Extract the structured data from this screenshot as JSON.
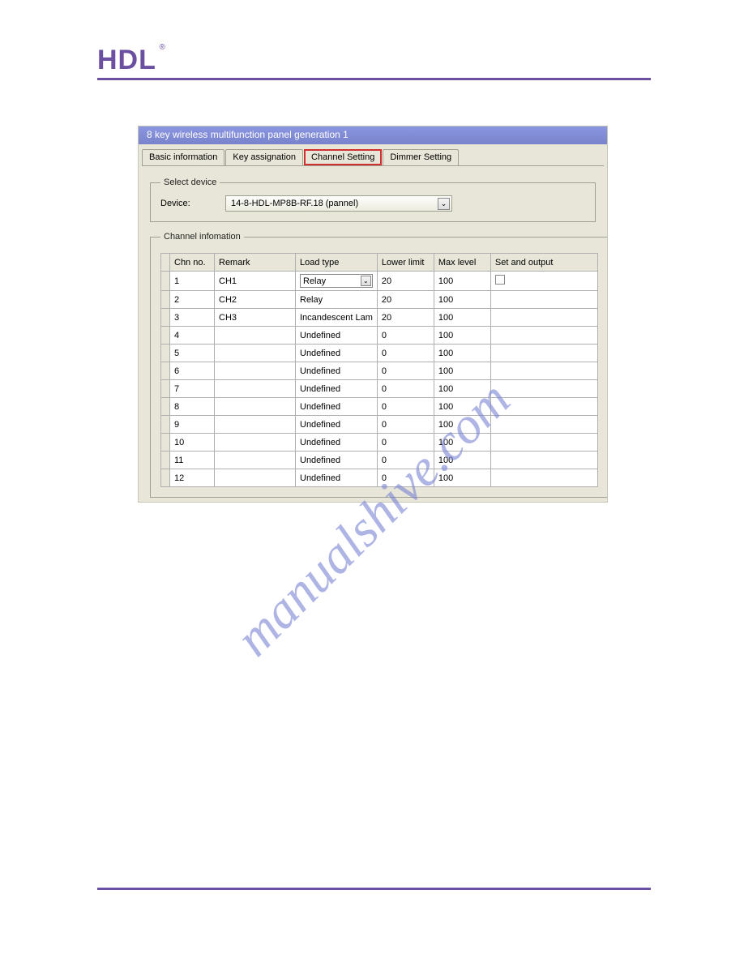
{
  "header": {
    "logo": "HDL",
    "reg": "®"
  },
  "watermark": "manualshive.com",
  "window": {
    "title": "8 key wireless multifunction panel generation 1",
    "tabs": [
      "Basic information",
      "Key assignation",
      "Channel Setting",
      "Dimmer Setting"
    ],
    "active_tab_index": 2,
    "select_device": {
      "legend": "Select device",
      "label": "Device:",
      "value": "14-8-HDL-MP8B-RF.18 (pannel)"
    },
    "channel_info": {
      "legend": "Channel infomation",
      "columns": [
        "Chn no.",
        "Remark",
        "Load type",
        "Lower limit",
        "Max level",
        "Set and output"
      ],
      "rows": [
        {
          "chn": "1",
          "remark": "CH1",
          "load": "Relay",
          "lower": "20",
          "max": "100",
          "dropdown": true,
          "checkbox": true
        },
        {
          "chn": "2",
          "remark": "CH2",
          "load": "Relay",
          "lower": "20",
          "max": "100"
        },
        {
          "chn": "3",
          "remark": "CH3",
          "load": "Incandescent Lam",
          "lower": "20",
          "max": "100"
        },
        {
          "chn": "4",
          "remark": "",
          "load": "Undefined",
          "lower": "0",
          "max": "100"
        },
        {
          "chn": "5",
          "remark": "",
          "load": "Undefined",
          "lower": "0",
          "max": "100"
        },
        {
          "chn": "6",
          "remark": "",
          "load": "Undefined",
          "lower": "0",
          "max": "100"
        },
        {
          "chn": "7",
          "remark": "",
          "load": "Undefined",
          "lower": "0",
          "max": "100"
        },
        {
          "chn": "8",
          "remark": "",
          "load": "Undefined",
          "lower": "0",
          "max": "100"
        },
        {
          "chn": "9",
          "remark": "",
          "load": "Undefined",
          "lower": "0",
          "max": "100"
        },
        {
          "chn": "10",
          "remark": "",
          "load": "Undefined",
          "lower": "0",
          "max": "100"
        },
        {
          "chn": "11",
          "remark": "",
          "load": "Undefined",
          "lower": "0",
          "max": "100"
        },
        {
          "chn": "12",
          "remark": "",
          "load": "Undefined",
          "lower": "0",
          "max": "100"
        }
      ]
    }
  }
}
